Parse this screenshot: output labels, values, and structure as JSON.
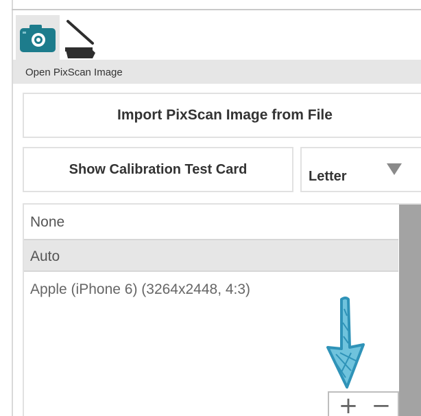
{
  "toolbar": {
    "tools": [
      {
        "icon": "camera-icon",
        "selected": true
      },
      {
        "icon": "scanner-icon",
        "selected": false
      }
    ],
    "selected_label": "Open PixScan Image"
  },
  "actions": {
    "import_label": "Import PixScan Image from File",
    "calibration_label": "Show Calibration Test Card"
  },
  "paper_size": {
    "selected": "Letter"
  },
  "camera_list": {
    "items": [
      {
        "label": "None",
        "selected": false
      },
      {
        "label": "Auto",
        "selected": true
      },
      {
        "label": "Apple (iPhone 6) (3264x2448, 4:3)",
        "selected": false
      }
    ],
    "add_symbol": "+",
    "remove_symbol": "−"
  },
  "colors": {
    "accent": "#1d7c8c",
    "annotation_arrow": "#3aa6c8",
    "selected_bg": "#e6e6e6",
    "scrollbar": "#a3a3a3"
  }
}
